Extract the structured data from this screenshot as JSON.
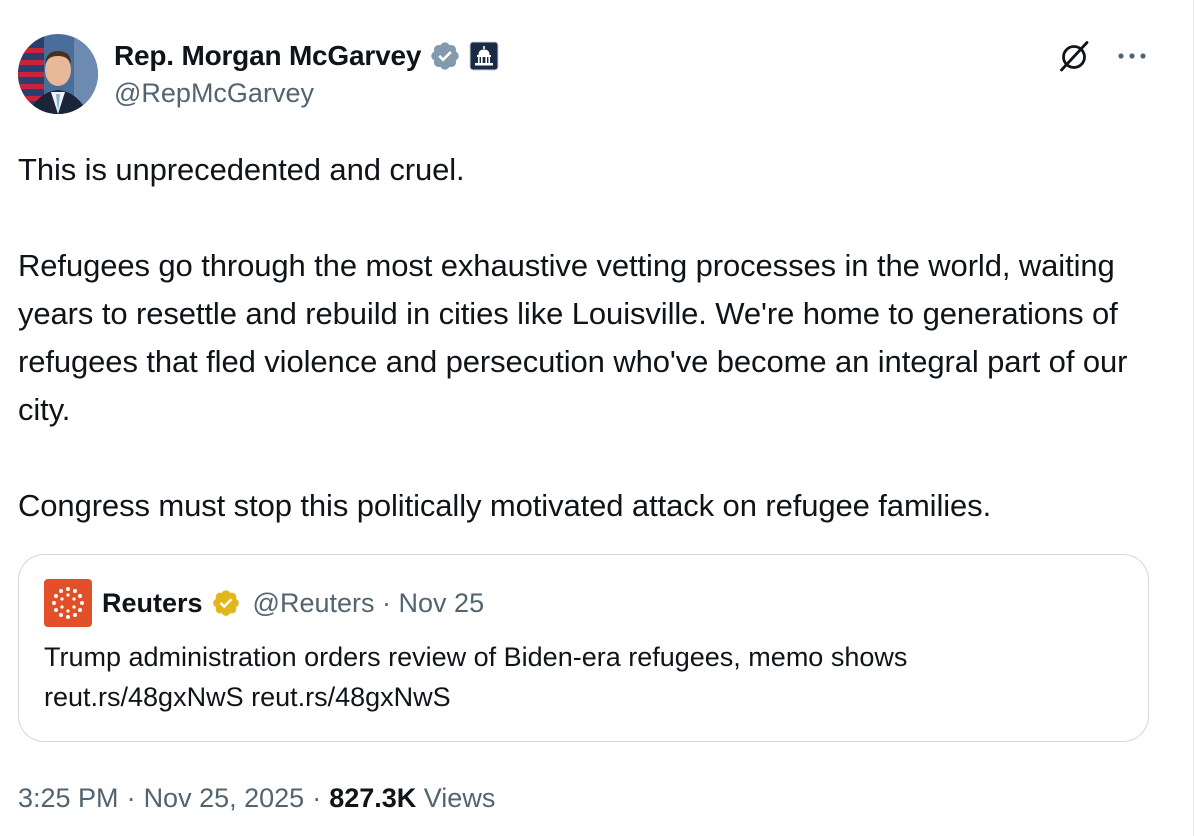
{
  "author": {
    "display_name": "Rep. Morgan McGarvey",
    "handle": "@RepMcGarvey",
    "verified_color": "#829aab",
    "affiliation": "US Congress"
  },
  "tweet": {
    "paragraphs": [
      "This is unprecedented and cruel.",
      "Refugees go through the most exhaustive vetting processes in the world, waiting years to resettle and rebuild in cities like Louisville. We're home to generations of refugees that fled violence and persecution who've become an integral part of our city.",
      "Congress must stop this politically motivated attack on refugee families."
    ]
  },
  "quoted": {
    "name": "Reuters",
    "handle": "@Reuters",
    "date": "Nov 25",
    "separator": "·",
    "text_line1": "Trump administration orders review of Biden-era refugees, memo shows",
    "text_line2": "reut.rs/48gxNwS reut.rs/48gxNwS",
    "logo_color": "#e2502a",
    "badge_color": "#e2b719"
  },
  "footer": {
    "time": "3:25 PM",
    "date": "Nov 25, 2025",
    "separator": "·",
    "views_count": "827.3K",
    "views_label": "Views"
  },
  "icons": {
    "grok": "grok-icon",
    "more": "more-icon"
  }
}
